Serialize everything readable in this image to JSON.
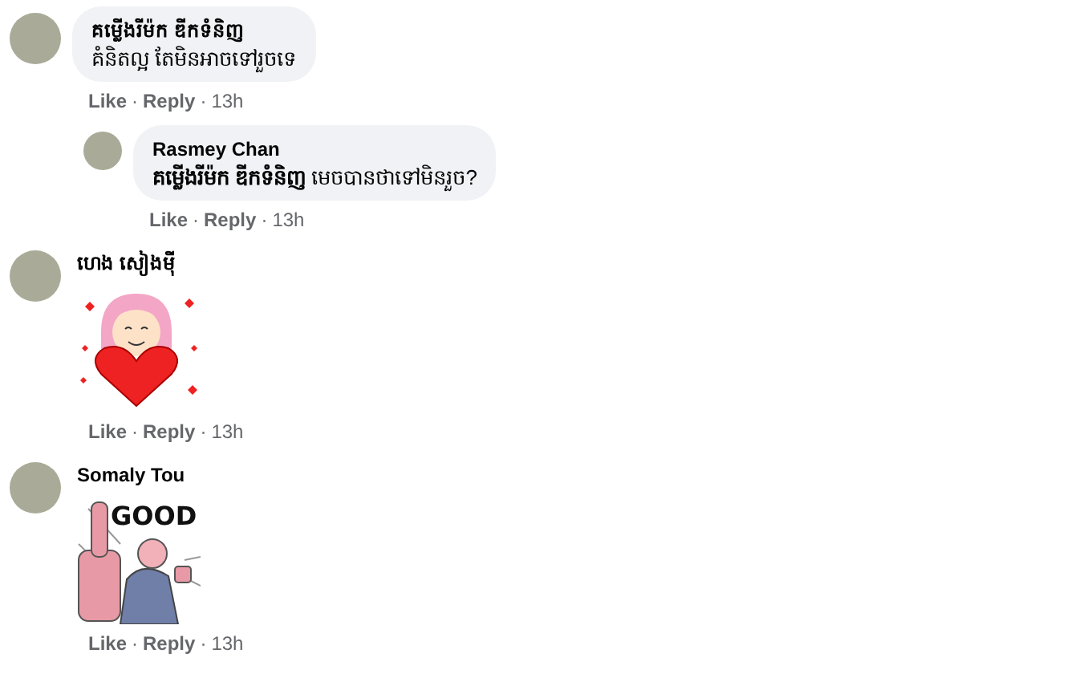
{
  "comments": [
    {
      "author": "គម្លើងរីម៉ក ឌីកទំនិញ",
      "kind": "text",
      "body": "គំនិតល្អ តែមិនអាចទៅរួចទេ",
      "actions": [
        "Like",
        "Reply"
      ],
      "separator": "·",
      "time": "13h",
      "replies": [
        {
          "author": "Rasmey Chan",
          "kind": "text",
          "body": "**គម្លើងរីម៉ក ឌីកទំនិញ** មេចបានថាទៅមិនរួច?",
          "actions": [
            "Like",
            "Reply"
          ],
          "separator": "·",
          "time": "13h"
        }
      ]
    },
    {
      "author": "ហេង សៀងមុី",
      "kind": "heart_sticker",
      "actions": [
        "Like",
        "Reply"
      ],
      "separator": "·",
      "time": "13h"
    },
    {
      "author": "Somaly Tou",
      "kind": "thumbs_sticker",
      "sticker_text": "GOOD",
      "actions": [
        "Like",
        "Reply"
      ],
      "separator": "·",
      "time": "13h"
    }
  ]
}
